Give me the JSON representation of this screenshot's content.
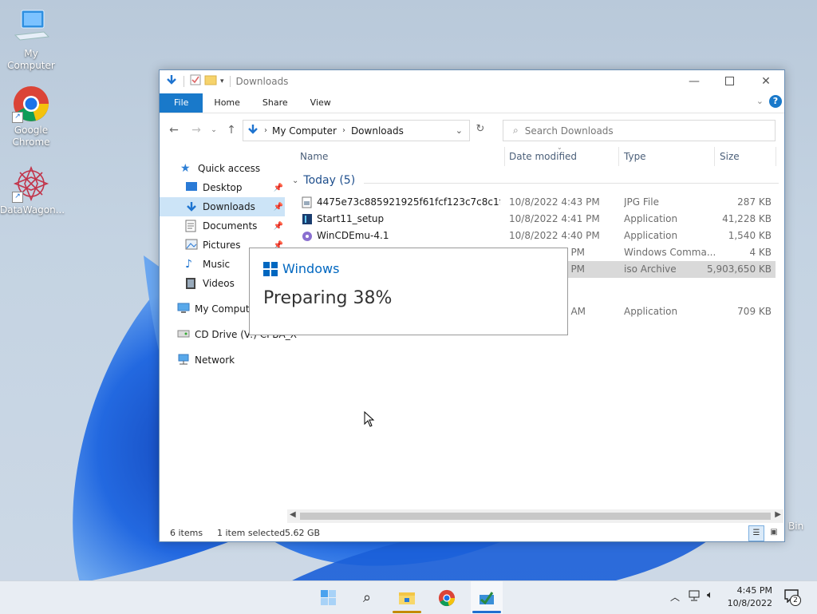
{
  "desktop": {
    "icons": [
      {
        "label": "My Computer",
        "icon": "computer-icon"
      },
      {
        "label": "Google\nChrome",
        "label_line1": "Google",
        "label_line2": "Chrome",
        "icon": "chrome-icon"
      },
      {
        "label": "DataWagon...",
        "icon": "datawagon-icon"
      }
    ],
    "recycle_partial": "Bin"
  },
  "explorer": {
    "title": "Downloads",
    "ribbon_tabs": [
      "File",
      "Home",
      "Share",
      "View"
    ],
    "breadcrumb": [
      "My Computer",
      "Downloads"
    ],
    "search_placeholder": "Search Downloads",
    "nav": [
      {
        "label": "Quick access",
        "icon": "star-icon"
      },
      {
        "label": "Desktop",
        "icon": "desktop-folder-icon",
        "pinned": true
      },
      {
        "label": "Downloads",
        "icon": "download-arrow-icon",
        "pinned": true,
        "selected": true
      },
      {
        "label": "Documents",
        "icon": "documents-icon",
        "pinned": true
      },
      {
        "label": "Pictures",
        "icon": "pictures-icon",
        "pinned": true
      },
      {
        "label": "Music",
        "icon": "music-icon"
      },
      {
        "label": "Videos",
        "icon": "videos-icon"
      },
      {
        "label": "My Compute",
        "icon": "computer-icon"
      },
      {
        "label": "CD Drive (V:) CPBA_X",
        "icon": "cd-drive-icon"
      },
      {
        "label": "Network",
        "icon": "network-icon"
      }
    ],
    "columns": [
      "Name",
      "Date modified",
      "Type",
      "Size"
    ],
    "group_label": "Today (5)",
    "files": [
      {
        "name": "4475e73c885921925f61fcf123c7c8c1f93e1...",
        "date": "10/8/2022 4:43 PM",
        "type": "JPG File",
        "size": "287 KB"
      },
      {
        "name": "Start11_setup",
        "date": "10/8/2022 4:41 PM",
        "type": "Application",
        "size": "41,228 KB"
      },
      {
        "name": "WinCDEmu-4.1",
        "date": "10/8/2022 4:40 PM",
        "type": "Application",
        "size": "1,540 KB"
      },
      {
        "name": "",
        "date": "0 PM",
        "type": "Windows Comma...",
        "size": "4 KB"
      },
      {
        "name": "",
        "date": "5 PM",
        "type": "iso Archive",
        "size": "5,903,650 KB",
        "selected": true
      },
      {
        "name": "",
        "date": "7 AM",
        "type": "Application",
        "size": "709 KB"
      }
    ],
    "status": {
      "items": "6 items",
      "selected": "1 item selected",
      "size": "5.62 GB"
    }
  },
  "dialog": {
    "brand": "Windows",
    "message": "Preparing 38%",
    "progress": 0.38
  },
  "taskbar": {
    "time": "4:45 PM",
    "date": "10/8/2022",
    "notification_count": "2"
  },
  "colors": {
    "accent": "#1979ca",
    "windows_blue": "#0067c0",
    "selection": "#cce4f7"
  }
}
